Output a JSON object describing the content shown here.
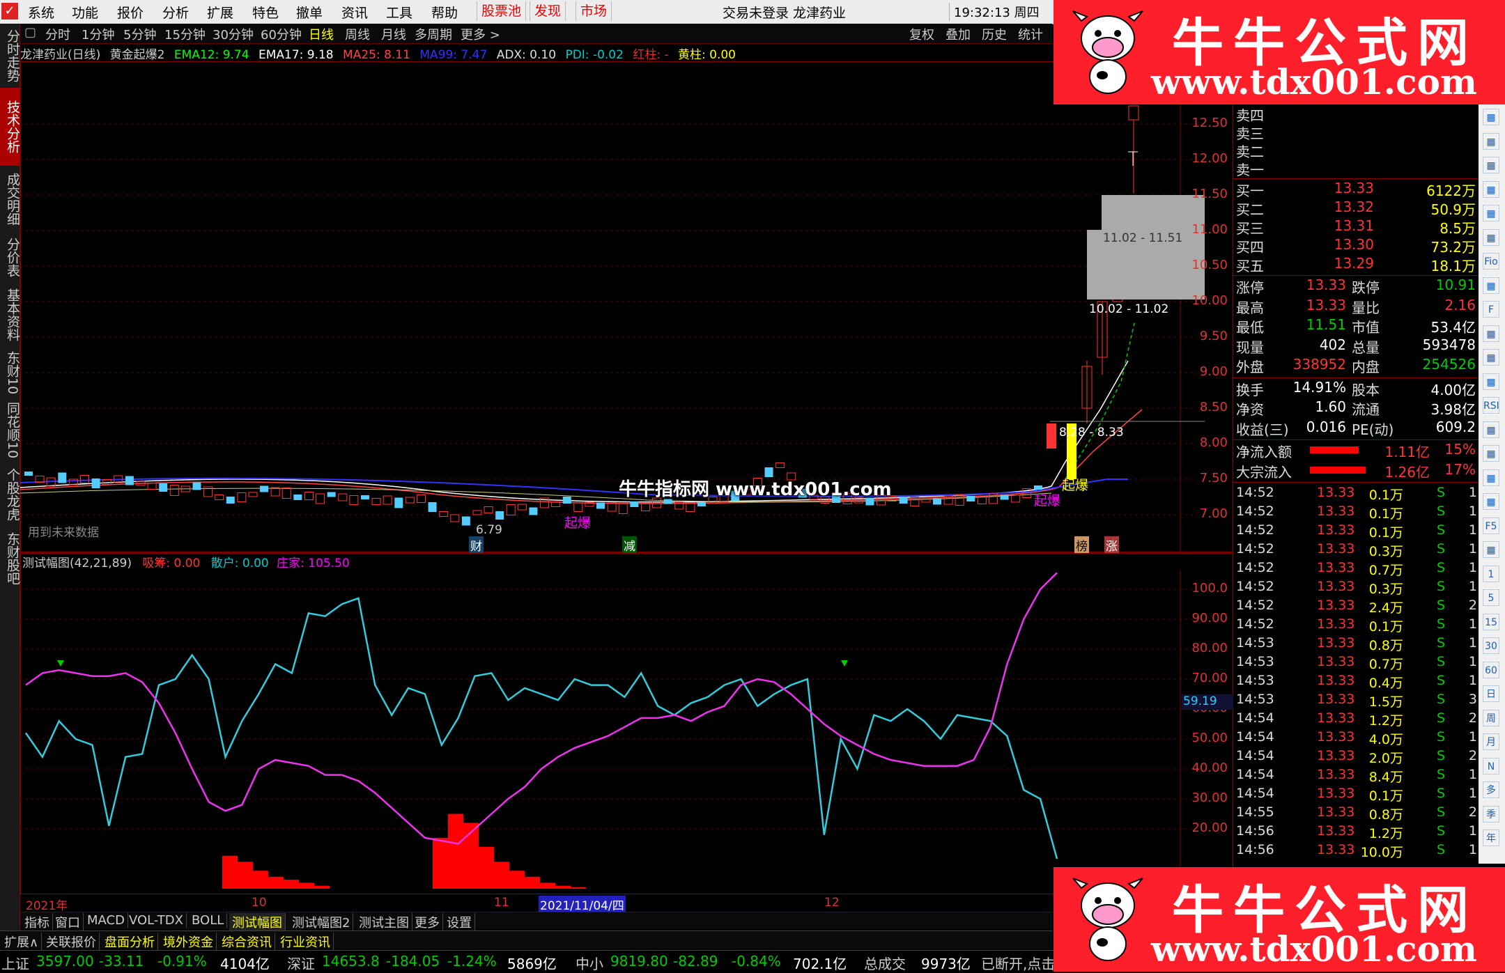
{
  "menubar": {
    "items": [
      "系统",
      "功能",
      "报价",
      "分析",
      "扩展",
      "特色",
      "撤单",
      "资讯",
      "工具",
      "帮助"
    ],
    "hot": [
      "股票池",
      "发现",
      "市场"
    ],
    "status": "交易未登录  龙津药业",
    "clock": "19:32:13 周四"
  },
  "lefttabs": [
    "分时走势",
    "技术分析",
    "成交明细",
    "分价表",
    "基本资料",
    "东财10",
    "同花顺10",
    "个股龙虎",
    "东财股吧"
  ],
  "period": {
    "items": [
      "分时",
      "1分钟",
      "5分钟",
      "15分钟",
      "30分钟",
      "60分钟",
      "日线",
      "周线",
      "月线",
      "多周期",
      "更多 >"
    ],
    "selected": "日线",
    "right_buttons": [
      "复权",
      "叠加",
      "历史",
      "统计"
    ]
  },
  "infoline": {
    "stock": "龙津药业(日线)",
    "formula": "黄金起爆2",
    "ema12": "EMA12: 9.74",
    "ema17": "EMA17: 9.18",
    "ma25": "MA25: 8.11",
    "ma99": "MA99: 7.47",
    "adx": "ADX: 0.10",
    "pdi": "PDI: -0.02",
    "hongzhu": "红柱: -",
    "huangzhu": "黄柱: 0.00"
  },
  "main_axis": [
    "12.50",
    "12.00",
    "11.50",
    "11.00",
    "10.50",
    "10.00",
    "9.50",
    "9.00",
    "8.50",
    "8.00",
    "7.50",
    "7.00"
  ],
  "main_labels": {
    "future": "用到未来数据",
    "low_price": "6.79",
    "qibao1": "起爆",
    "qibao2": "起爆",
    "qibao3": "起爆",
    "box1": "11.02 - 11.51",
    "box2": "10.02 - 11.02",
    "box3": "8.28 - 8.33",
    "mark_cai": "财",
    "mark_jian": "减",
    "mark_bang": "榜",
    "mark_zhang": "涨"
  },
  "watermark": "牛牛指标网 www.tdx001.com",
  "sub_info": {
    "name": "测试幅图(42,21,89)",
    "xichou": "吸筹: 0.00",
    "sanhu": "散户: 0.00",
    "zhuangjia": "庄家: 105.50"
  },
  "sub_axis": [
    "100.0",
    "90.00",
    "80.00",
    "70.00",
    "60.00",
    "50.00",
    "40.00",
    "30.00",
    "20.00"
  ],
  "sub_current": "59.19",
  "chart_data": {
    "type": "line",
    "main_price": {
      "ylim": [
        6.79,
        12.5
      ]
    },
    "sub_chart": {
      "ylim": [
        20,
        100
      ],
      "series": [
        {
          "name": "散户",
          "values": [
            52,
            44,
            56,
            50,
            48,
            21,
            44,
            45,
            68,
            70,
            78,
            70,
            44,
            56,
            65,
            75,
            72,
            92,
            91,
            95,
            97,
            68,
            58,
            67,
            65,
            48,
            57,
            71,
            72,
            63,
            67,
            65,
            63,
            70,
            68,
            68,
            64,
            72,
            61,
            58,
            62,
            64,
            68,
            70,
            61,
            65,
            68,
            70,
            18,
            50,
            40,
            58,
            56,
            60,
            56,
            50,
            58,
            57,
            56,
            51,
            33,
            30,
            10
          ]
        },
        {
          "name": "庄家",
          "values": [
            68,
            72,
            73,
            72,
            71,
            71,
            72,
            69,
            62,
            52,
            40,
            29,
            26,
            28,
            40,
            43,
            42,
            41,
            38,
            38,
            36,
            32,
            27,
            22,
            17,
            16,
            15,
            20,
            25,
            30,
            34,
            40,
            44,
            47,
            49,
            51,
            54,
            57,
            57,
            58,
            56,
            59,
            61,
            68,
            70,
            69,
            65,
            60,
            55,
            51,
            48,
            45,
            43,
            42,
            41,
            41,
            41,
            43,
            54,
            75,
            90,
            100,
            105.5
          ]
        }
      ],
      "bars": [
        {
          "name": "吸筹",
          "values": [
            11,
            9,
            6,
            4,
            3,
            2,
            1
          ]
        },
        {
          "name": "吸筹",
          "values": [
            17,
            25,
            22,
            14,
            9,
            6,
            4,
            2,
            1,
            0.5
          ]
        }
      ]
    }
  },
  "quotes": {
    "sell": [
      [
        "卖四",
        "",
        ""
      ],
      [
        "卖三",
        "",
        ""
      ],
      [
        "卖二",
        "",
        ""
      ],
      [
        "卖一",
        "",
        ""
      ]
    ],
    "buy": [
      [
        "买一",
        "13.33",
        "6122万"
      ],
      [
        "买二",
        "13.32",
        "50.9万"
      ],
      [
        "买三",
        "13.31",
        "8.5万"
      ],
      [
        "买四",
        "13.30",
        "73.2万"
      ],
      [
        "买五",
        "13.29",
        "18.1万"
      ]
    ],
    "stats": [
      [
        "涨停",
        "13.33",
        "跌停",
        "10.91"
      ],
      [
        "最高",
        "13.33",
        "量比",
        "2.16"
      ],
      [
        "最低",
        "11.51",
        "市值",
        "53.4亿"
      ],
      [
        "现量",
        "402",
        "总量",
        "593478"
      ],
      [
        "外盘",
        "338952",
        "内盘",
        "254526"
      ]
    ],
    "stats2": [
      [
        "换手",
        "14.91%",
        "股本",
        "4.00亿"
      ],
      [
        "净资",
        "1.60",
        "流通",
        "3.98亿"
      ],
      [
        "收益(三)",
        "0.016",
        "PE(动)",
        "609.2"
      ]
    ],
    "flow": [
      [
        "净流入额",
        "1.11亿",
        "15%"
      ],
      [
        "大宗流入",
        "1.26亿",
        "17%"
      ]
    ],
    "ticks": [
      [
        "14:52",
        "13.33",
        "0.1万",
        "S",
        "1"
      ],
      [
        "14:52",
        "13.33",
        "0.1万",
        "S",
        "1"
      ],
      [
        "14:52",
        "13.33",
        "0.1万",
        "S",
        "1"
      ],
      [
        "14:52",
        "13.33",
        "0.3万",
        "S",
        "1"
      ],
      [
        "14:52",
        "13.33",
        "0.7万",
        "S",
        "1"
      ],
      [
        "14:52",
        "13.33",
        "0.3万",
        "S",
        "1"
      ],
      [
        "14:52",
        "13.33",
        "2.4万",
        "S",
        "2"
      ],
      [
        "14:52",
        "13.33",
        "0.1万",
        "S",
        "1"
      ],
      [
        "14:53",
        "13.33",
        "0.8万",
        "S",
        "1"
      ],
      [
        "14:53",
        "13.33",
        "0.7万",
        "S",
        "1"
      ],
      [
        "14:53",
        "13.33",
        "0.4万",
        "S",
        "1"
      ],
      [
        "14:53",
        "13.33",
        "1.5万",
        "S",
        "3"
      ],
      [
        "14:54",
        "13.33",
        "1.2万",
        "S",
        "2"
      ],
      [
        "14:54",
        "13.33",
        "4.0万",
        "S",
        "1"
      ],
      [
        "14:54",
        "13.33",
        "2.0万",
        "S",
        "2"
      ],
      [
        "14:54",
        "13.33",
        "8.4万",
        "S",
        "1"
      ],
      [
        "14:54",
        "13.33",
        "0.1万",
        "S",
        "1"
      ],
      [
        "14:55",
        "13.33",
        "0.8万",
        "S",
        "2"
      ],
      [
        "14:56",
        "13.33",
        "1.2万",
        "S",
        "1"
      ],
      [
        "14:56",
        "13.33",
        "10.0万",
        "S",
        "1"
      ]
    ]
  },
  "iconstrip": [
    "",
    "",
    "",
    "",
    "",
    "",
    "Fio",
    "",
    "F",
    "",
    "",
    "",
    "RSI",
    "",
    "",
    "",
    "",
    "F5",
    "",
    "1",
    "5",
    "15",
    "30",
    "60",
    "日",
    "周",
    "月",
    "N",
    "多",
    "季",
    "年"
  ],
  "xaxis": {
    "y2021": "2021年",
    "m10": "10",
    "m11": "11",
    "date": "2021/11/04/四",
    "m12": "12"
  },
  "tabs": [
    "指标",
    "窗口",
    "MACD",
    "VOL-TDX",
    "BOLL",
    "测试幅图",
    "测试幅图2",
    "测试主图",
    "更多",
    "设置"
  ],
  "tabs_selected": "测试幅图",
  "ext": [
    "扩展∧",
    "关联报价",
    "盘面分析",
    "境外资金",
    "综合资讯",
    "行业资讯"
  ],
  "indexbar": {
    "sh_name": "上证",
    "sh_val": "3597.00",
    "sh_chg": "-33.11",
    "sh_pct": "-0.91%",
    "sh_amt": "4104亿",
    "sz_name": "深证",
    "sz_val": "14653.8",
    "sz_chg": "-184.05",
    "sz_pct": "-1.24%",
    "sz_amt": "5869亿",
    "zx_name": "中小",
    "zx_val": "9819.80",
    "zx_chg": "-82.89",
    "zx_pct": "-0.84%",
    "zx_amt": "702.1亿",
    "tot_name": "总成交",
    "tot_amt": "9973亿",
    "conn": "已断开,点击"
  },
  "ad": {
    "title": "牛牛公式网",
    "url": "www.tdx001.com"
  }
}
